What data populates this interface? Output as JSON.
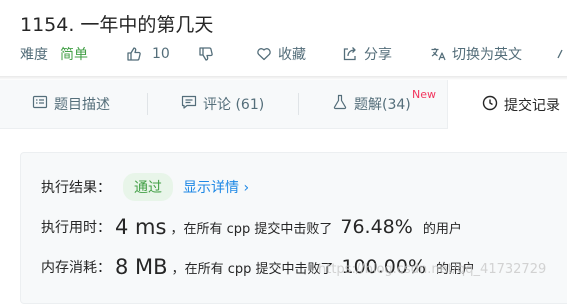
{
  "problem": {
    "title": "1154. 一年中的第几天"
  },
  "toolbar": {
    "difficulty_label": "难度",
    "difficulty_value": "简单",
    "likes": "10",
    "favorite_label": "收藏",
    "share_label": "分享",
    "lang_label": "切换为英文"
  },
  "tabs": {
    "description": "题目描述",
    "comments": "评论 (61)",
    "solutions": "题解(34)",
    "new_badge": "New",
    "submissions": "提交记录"
  },
  "result": {
    "label": "执行结果：",
    "status": "通过",
    "details": "显示详情",
    "time_label": "执行用时：",
    "time_value": "4 ms",
    "time_text": "，在所有 cpp 提交中击败了",
    "time_pct": "76.48%",
    "time_suffix": "的用户",
    "mem_label": "内存消耗：",
    "mem_value": "8 MB",
    "mem_text": "，在所有 cpp 提交中击败了",
    "mem_pct": "100.00%",
    "mem_suffix": "的用户"
  },
  "watermark": "https://blog.csdn.net/qq_41732729",
  "colors": {
    "easy": "#43a047",
    "link": "#1e88e5",
    "new": "#f2365e"
  }
}
